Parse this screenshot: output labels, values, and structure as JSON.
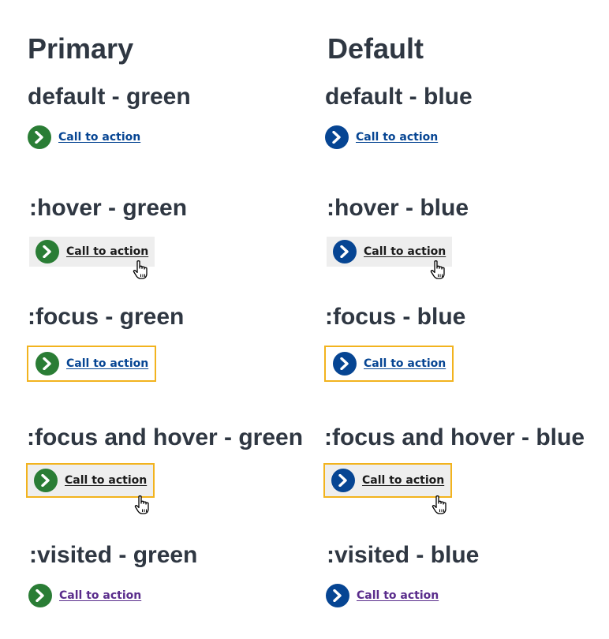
{
  "columns": {
    "primary": {
      "title": "Primary"
    },
    "default": {
      "title": "Default"
    }
  },
  "states": {
    "default_green": "default - green",
    "default_blue": "default - blue",
    "hover_green": ":hover - green",
    "hover_blue": ":hover - blue",
    "focus_green": ":focus - green",
    "focus_blue": ":focus - blue",
    "focus_hover_green": ":focus and hover - green",
    "focus_hover_blue": ":focus and hover - blue",
    "visited_green": ":visited - green",
    "visited_blue": ":visited - blue"
  },
  "cta_label": "Call to action",
  "icons": {
    "chevron": "chevron-right-icon",
    "cursor": "hand-pointer-cursor-icon"
  },
  "colors": {
    "green": "#2a7d35",
    "blue": "#064593",
    "focus_outline": "#f2b31e",
    "hover_background": "#eeeeee",
    "link": "#064593",
    "link_hover": "#1b1b1b",
    "link_visited": "#5a2d8c"
  }
}
